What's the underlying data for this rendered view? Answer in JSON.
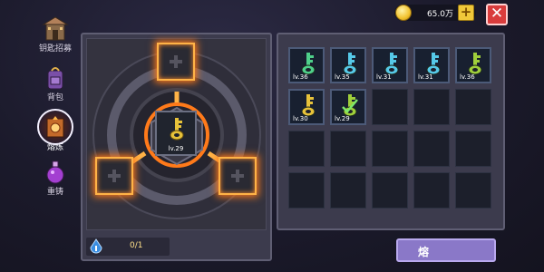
{
  "nav": {
    "items": [
      {
        "label": "钥匙招募",
        "icon": "shrine-icon"
      },
      {
        "label": "背包",
        "icon": "backpack-icon"
      },
      {
        "label": "熔炼",
        "icon": "furnace-icon",
        "active": true
      },
      {
        "label": "重铸",
        "icon": "potion-icon"
      }
    ]
  },
  "currency": {
    "amount": "65.0万",
    "add_label": "+",
    "icon": "coin-icon"
  },
  "close_label": "✕",
  "forge": {
    "center_item": {
      "level": "lv.29",
      "color": "#e7c23a"
    },
    "progress": "0/1"
  },
  "inventory": {
    "items": [
      {
        "level": "lv.36",
        "color": "#4fd08a"
      },
      {
        "level": "lv.35",
        "color": "#56c9e8"
      },
      {
        "level": "lv.31",
        "color": "#56c9e8"
      },
      {
        "level": "lv.31",
        "color": "#56c9e8"
      },
      {
        "level": "lv.36",
        "color": "#9fcf3b"
      },
      {
        "level": "lv.30",
        "color": "#e7c23a"
      },
      {
        "level": "lv.29",
        "color": "#9fcf3b",
        "marked": true
      }
    ]
  },
  "fuse_button": {
    "label": "熔"
  }
}
